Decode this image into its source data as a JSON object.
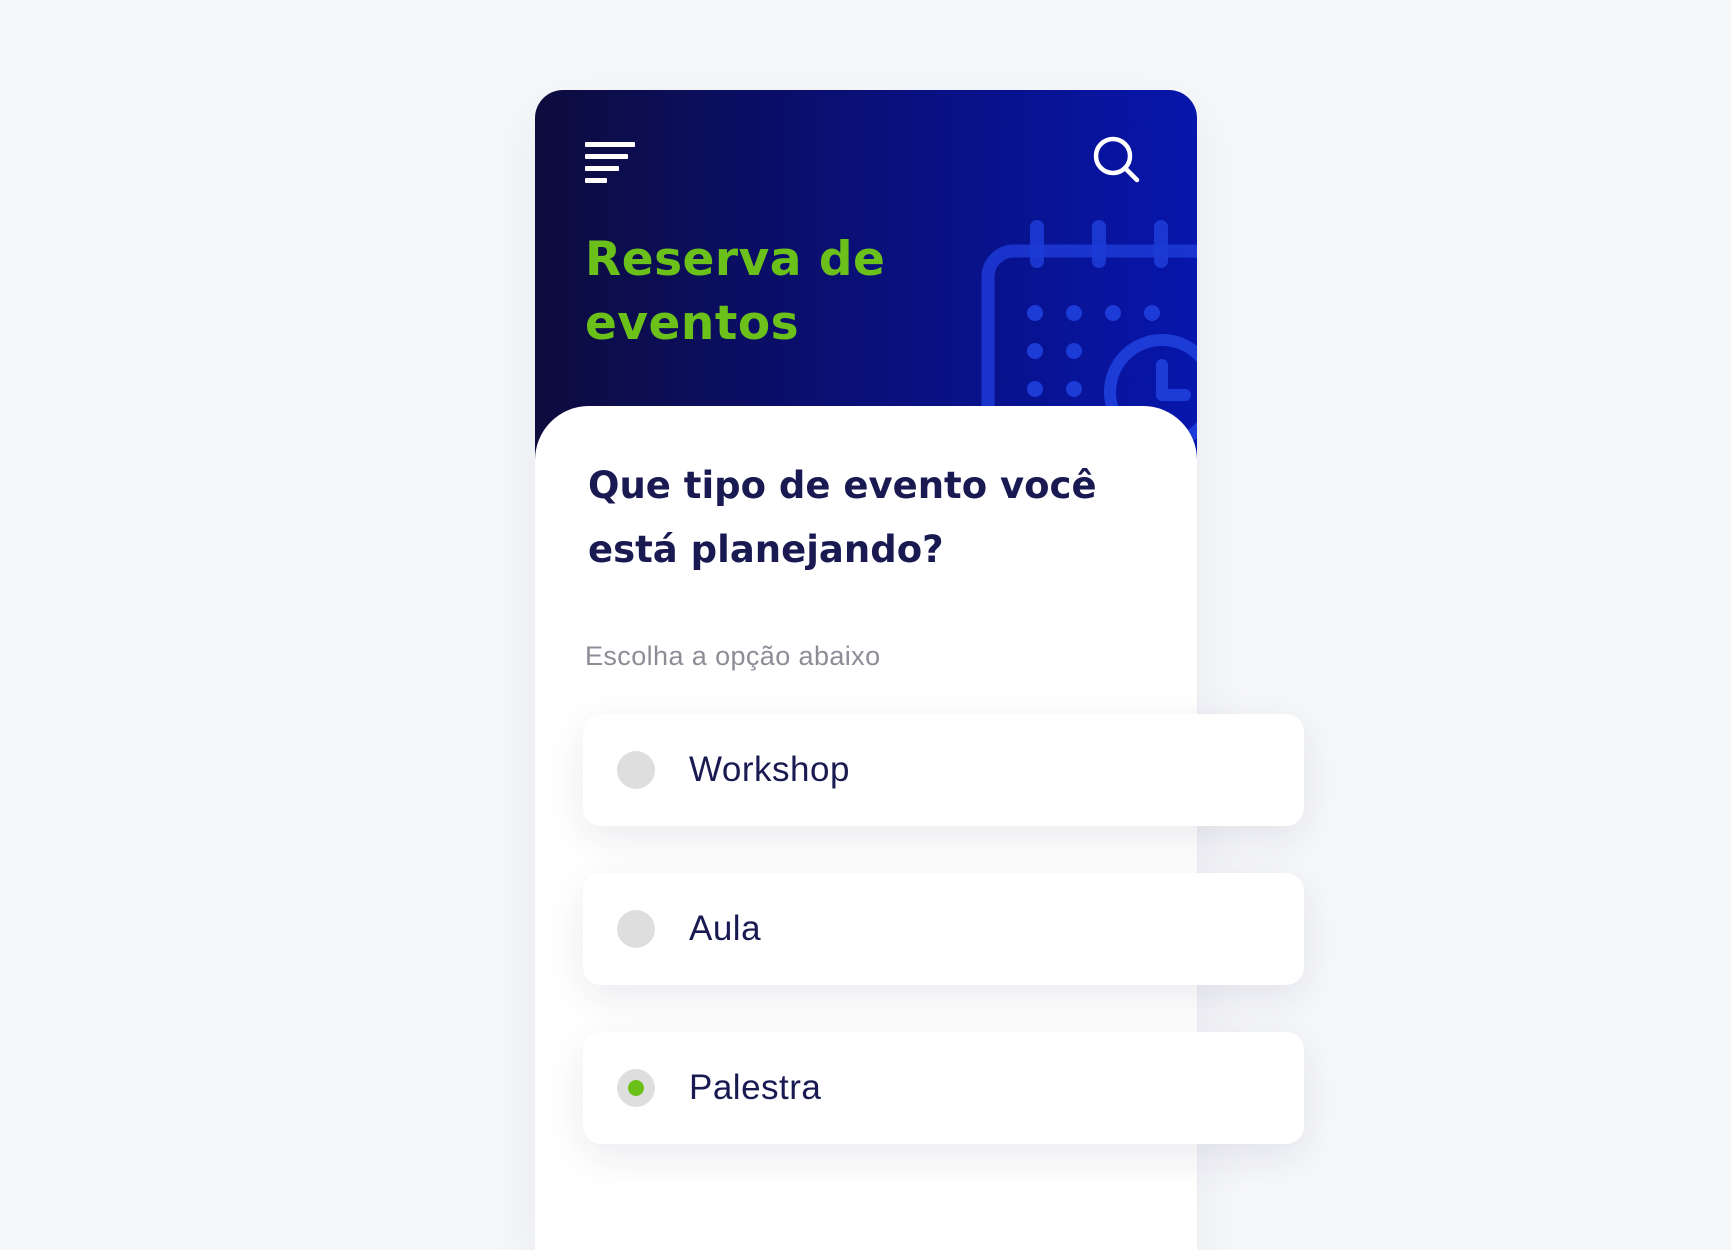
{
  "header": {
    "title_line1": "Reserva de",
    "title_line2": "eventos",
    "menu_icon": "menu-icon",
    "search_icon": "search-icon",
    "decoration_icon": "calendar-clock-icon"
  },
  "form": {
    "question_line1": "Que tipo de evento você",
    "question_line2": "está planejando?",
    "subtitle": "Escolha a opção abaixo",
    "options": [
      {
        "label": "Workshop",
        "selected": false
      },
      {
        "label": "Aula",
        "selected": false
      },
      {
        "label": "Palestra",
        "selected": true
      }
    ]
  },
  "colors": {
    "accent_green": "#6bc11a",
    "header_dark": "#0d0c3d",
    "header_blue": "#0716ac",
    "text_navy": "#1a1a52",
    "radio_grey": "#dedede",
    "background": "#f6f7fa"
  }
}
